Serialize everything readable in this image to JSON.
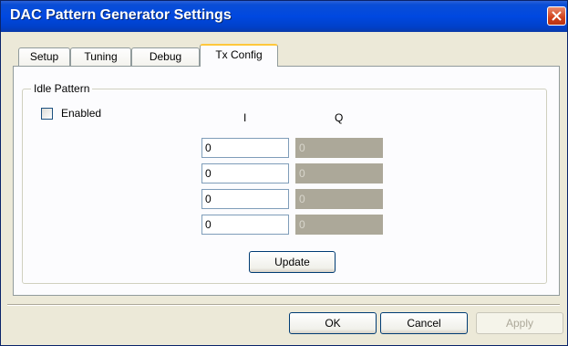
{
  "window": {
    "title": "DAC Pattern Generator Settings"
  },
  "tabs": [
    {
      "label": "Setup"
    },
    {
      "label": "Tuning"
    },
    {
      "label": "Debug"
    },
    {
      "label": "Tx Config",
      "active": true
    }
  ],
  "idle_pattern": {
    "group_label": "Idle Pattern",
    "enabled_label": "Enabled",
    "enabled": false,
    "col_i_label": "I",
    "col_q_label": "Q",
    "rows": [
      {
        "i": "0",
        "q": "0"
      },
      {
        "i": "0",
        "q": "0"
      },
      {
        "i": "0",
        "q": "0"
      },
      {
        "i": "0",
        "q": "0"
      }
    ],
    "update_label": "Update"
  },
  "buttons": {
    "ok": "OK",
    "cancel": "Cancel",
    "apply": "Apply"
  },
  "colors": {
    "titlebar": "#0048e0",
    "close": "#d1411b",
    "dialog_bg": "#ece9d8",
    "active_tab_accent": "#ffc83c"
  }
}
